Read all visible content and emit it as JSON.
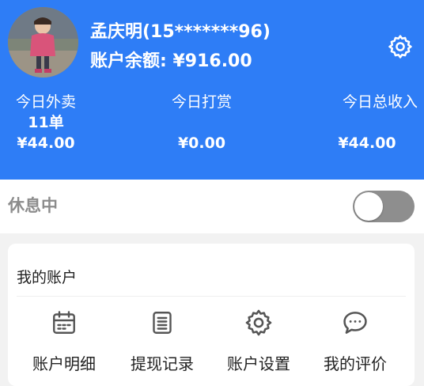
{
  "user": {
    "name": "孟庆明(15*******96)",
    "balance": "账户余额: ¥916.00"
  },
  "icons": {
    "settings": "gear-icon",
    "avatar": "user-avatar-photo"
  },
  "stats": [
    {
      "label": "今日外卖",
      "count": "11单",
      "amount": "¥44.00"
    },
    {
      "label": "今日打赏",
      "amount": "¥0.00"
    },
    {
      "label": "今日总收入",
      "amount": "¥44.00"
    }
  ],
  "rest": {
    "label": "休息中",
    "toggle_on": false
  },
  "account": {
    "title": "我的账户",
    "items": [
      {
        "label": "账户明细",
        "icon": "calendar-icon"
      },
      {
        "label": "提现记录",
        "icon": "clipboard-list-icon"
      },
      {
        "label": "账户设置",
        "icon": "gear-icon"
      },
      {
        "label": "我的评价",
        "icon": "chat-bubble-icon"
      }
    ]
  },
  "colors": {
    "header_bg": "#2e7df6",
    "toggle_off": "#8e8e8e",
    "icon_gray": "#555555"
  }
}
